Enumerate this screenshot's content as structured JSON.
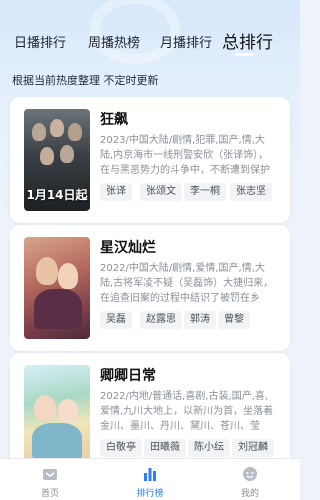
{
  "tabs": [
    "日播排行",
    "周播热榜",
    "月播排行",
    "总排行"
  ],
  "active_tab": "总排行",
  "subtitle": "根据当前热度整理 不定时更新",
  "cards": [
    {
      "title": "狂飙",
      "poster_caption": "1月14日起",
      "desc": "2023/中国大陆/剧情,犯罪,国产,情,大陆,内京海市一线刑警安欣（张译饰），在与黑恶势力的斗争中，不断遭到保护伞的打",
      "tags": [
        "张译",
        "张颂文",
        "李一桐",
        "张志坚"
      ]
    },
    {
      "title": "星汉灿烂",
      "poster_caption": "",
      "desc": "2022/中国大陆/剧情,爱情,国产,情,大陆,古将军凌不疑（吴磊饰）大捷归来，在追查旧案的过程中结识了被罚在乡野\"思过\"...",
      "tags": [
        "吴磊",
        "赵露思",
        "郭涛",
        "曾黎"
      ]
    },
    {
      "title": "卿卿日常",
      "poster_caption": "",
      "desc": "2022/内地/普通话,喜剧,古装,国产,喜,爱情,九川大地上，以新川为首，坐落着金川、墨川、丹川、黛川、苍川、莹川、胭川",
      "tags": [
        "白敬亭",
        "田曦薇",
        "陈小纭",
        "刘冠麟"
      ]
    }
  ],
  "nav": [
    {
      "label": "首页",
      "icon": "home-icon"
    },
    {
      "label": "排行榜",
      "icon": "ranking-icon"
    },
    {
      "label": "我的",
      "icon": "profile-icon"
    }
  ],
  "colors": {
    "accent": "#2f7cf6",
    "tag_bg": "#f2f3f5"
  }
}
